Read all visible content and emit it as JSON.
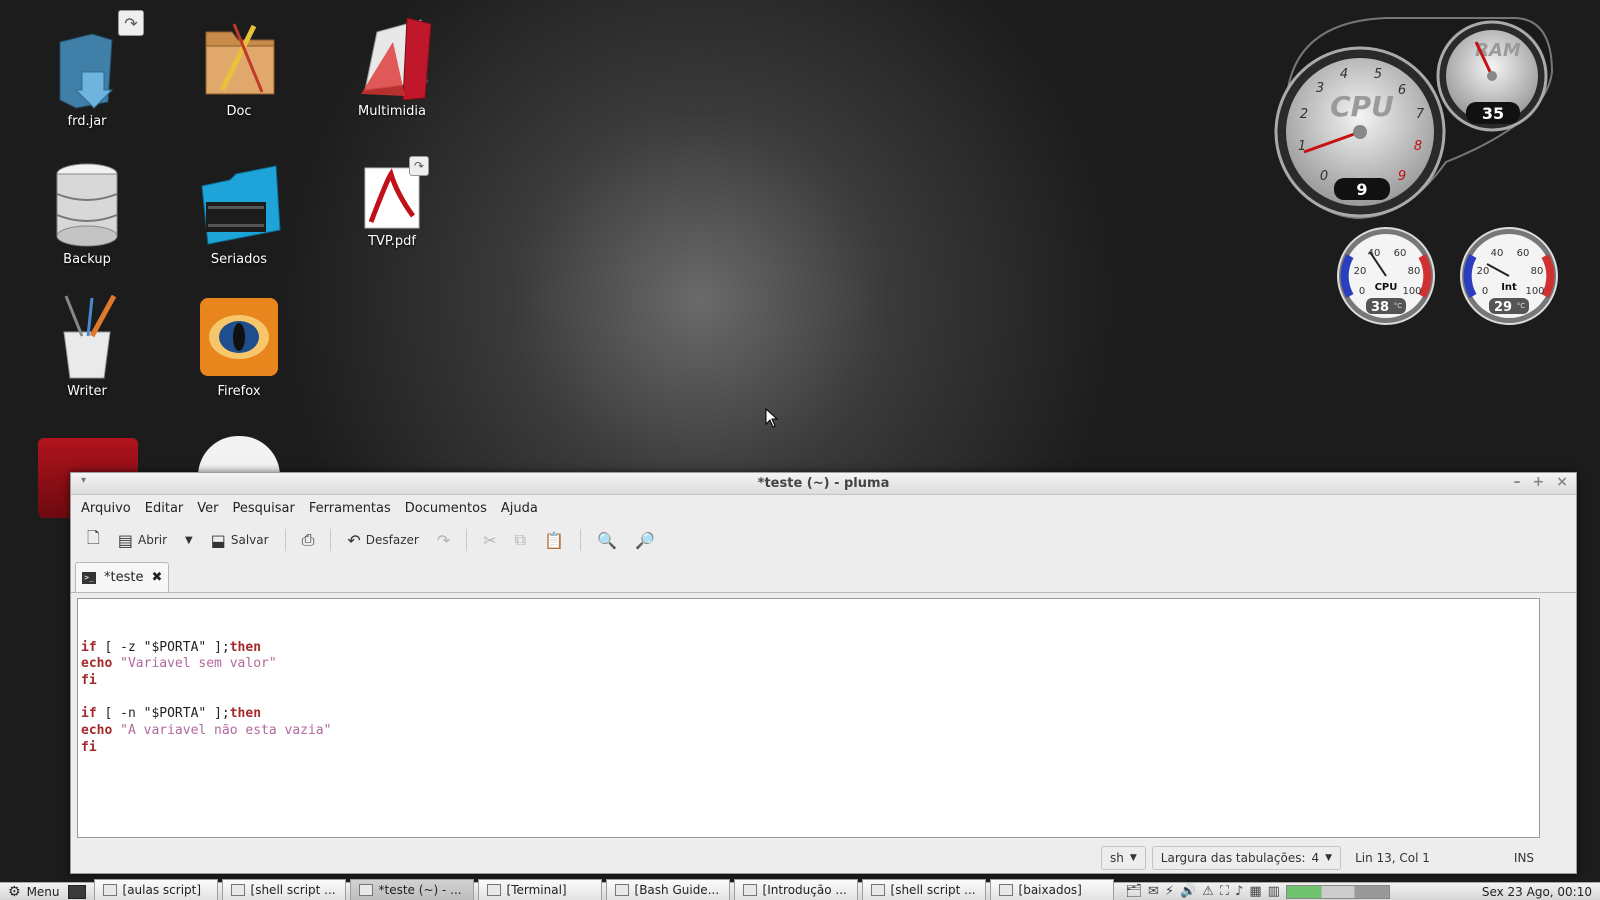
{
  "desktop": {
    "icons": [
      {
        "label": "frd.jar"
      },
      {
        "label": "Doc"
      },
      {
        "label": "Multimidia"
      },
      {
        "label": "Backup"
      },
      {
        "label": "Seriados"
      },
      {
        "label": "TVP.pdf"
      },
      {
        "label": "Writer"
      },
      {
        "label": "Firefox"
      }
    ]
  },
  "gauges": {
    "cpu_main": {
      "label": "CPU",
      "value": "9",
      "ticks": [
        "0",
        "1",
        "2",
        "3",
        "4",
        "5",
        "6",
        "7",
        "8",
        "9"
      ]
    },
    "ram": {
      "label": "RAM",
      "value": "35"
    },
    "cpu_temp": {
      "label": "CPU",
      "value": "38",
      "unit": "°C",
      "ticks": [
        "0",
        "20",
        "40",
        "60",
        "80",
        "100"
      ]
    },
    "int_temp": {
      "label": "Int",
      "value": "29",
      "unit": "°C",
      "ticks": [
        "0",
        "20",
        "40",
        "60",
        "80",
        "100"
      ]
    }
  },
  "window": {
    "title": "*teste (~) - pluma",
    "menu": [
      "Arquivo",
      "Editar",
      "Ver",
      "Pesquisar",
      "Ferramentas",
      "Documentos",
      "Ajuda"
    ],
    "toolbar": {
      "open_label": "Abrir",
      "save_label": "Salvar",
      "undo_label": "Desfazer"
    },
    "tab": {
      "label": "*teste"
    },
    "code": [
      [
        {
          "t": "if",
          "c": "kw"
        },
        {
          "t": " [ -z ",
          "c": "plain"
        },
        {
          "t": "\"$PORTA\"",
          "c": "plain"
        },
        {
          "t": " ];",
          "c": "plain"
        },
        {
          "t": "then",
          "c": "kw"
        }
      ],
      [
        {
          "t": "echo",
          "c": "kw"
        },
        {
          "t": " ",
          "c": "plain"
        },
        {
          "t": "\"Variavel sem valor\"",
          "c": "str"
        }
      ],
      [
        {
          "t": "fi",
          "c": "kw"
        }
      ],
      [],
      [
        {
          "t": "if",
          "c": "kw"
        },
        {
          "t": " [ -n ",
          "c": "plain"
        },
        {
          "t": "\"$PORTA\"",
          "c": "plain"
        },
        {
          "t": " ];",
          "c": "plain"
        },
        {
          "t": "then",
          "c": "kw"
        }
      ],
      [
        {
          "t": "echo",
          "c": "kw"
        },
        {
          "t": " ",
          "c": "plain"
        },
        {
          "t": "\"A variavel não esta vazia\"",
          "c": "str"
        }
      ],
      [
        {
          "t": "fi",
          "c": "kw"
        }
      ]
    ],
    "status": {
      "language": "sh",
      "tab_width": "Largura das tabulações:",
      "tab_width_value": "4",
      "position": "Lin 13, Col 1",
      "mode": "INS"
    }
  },
  "taskbar": {
    "menu_label": "Menu",
    "buttons": [
      {
        "label": "[aulas script]",
        "active": false
      },
      {
        "label": "[shell script ...",
        "active": false
      },
      {
        "label": "*teste (~) - ...",
        "active": true
      },
      {
        "label": "[Terminal]",
        "active": false
      },
      {
        "label": "[Bash Guide...",
        "active": false
      },
      {
        "label": "[Introdução ...",
        "active": false
      },
      {
        "label": "[shell script ...",
        "active": false
      },
      {
        "label": "[baixados]",
        "active": false
      }
    ],
    "clock": "Sex 23 Ago, 00:10"
  }
}
